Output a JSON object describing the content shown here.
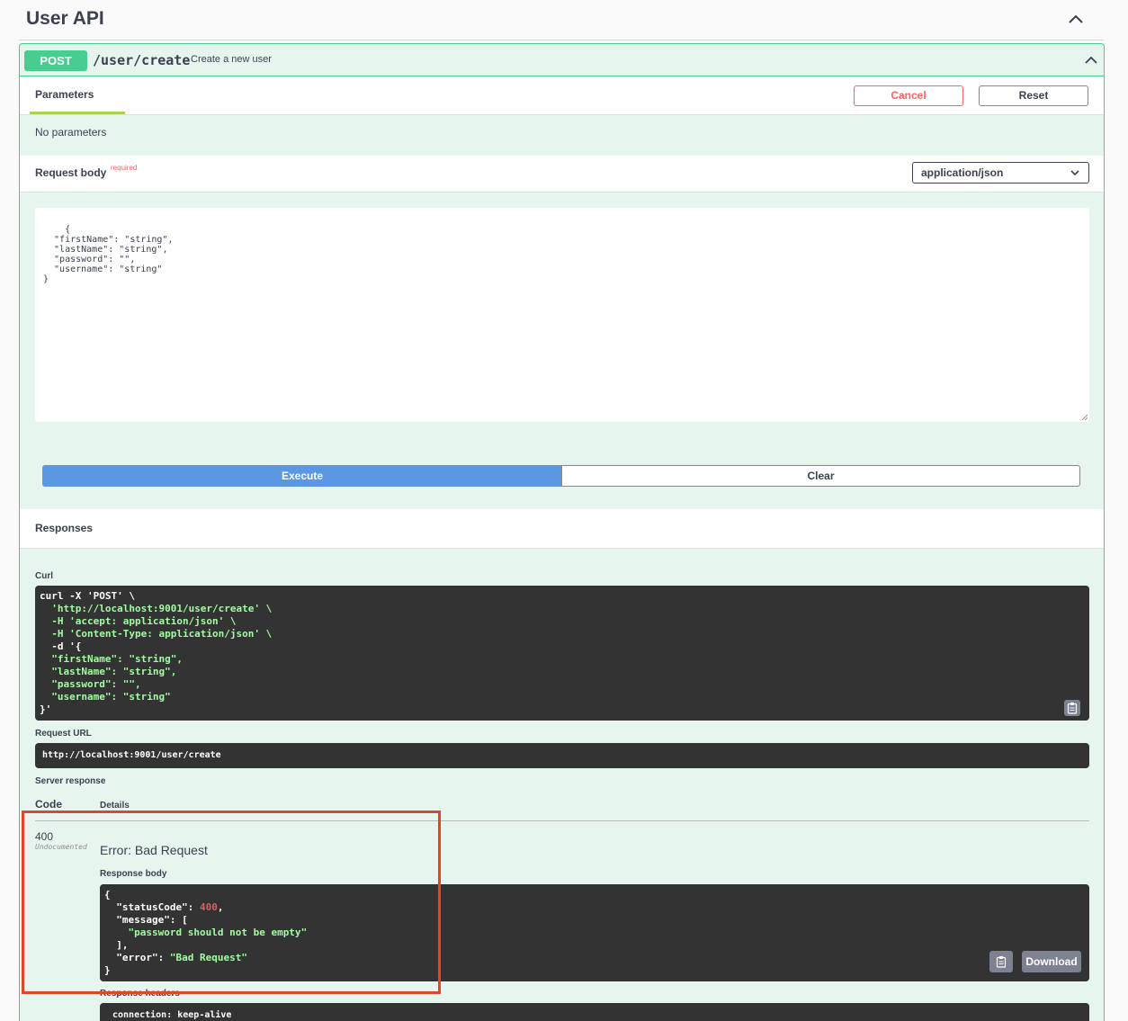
{
  "section": {
    "title": "User API"
  },
  "operation": {
    "method": "POST",
    "path": "/user/create",
    "summary": "Create a new user"
  },
  "parameters": {
    "tab_label": "Parameters",
    "cancel_label": "Cancel",
    "reset_label": "Reset",
    "empty_text": "No parameters"
  },
  "request_body": {
    "title": "Request body",
    "required_label": "required",
    "content_type": "application/json",
    "value": "{\n  \"firstName\": \"string\",\n  \"lastName\": \"string\",\n  \"password\": \"\",\n  \"username\": \"string\"\n}"
  },
  "actions": {
    "execute_label": "Execute",
    "clear_label": "Clear"
  },
  "responses": {
    "title": "Responses",
    "curl_label": "Curl",
    "curl_lines": [
      "curl -X 'POST' \\",
      "  'http://localhost:9001/user/create' \\",
      "  -H 'accept: application/json' \\",
      "  -H 'Content-Type: application/json' \\",
      "  -d '{",
      "  \"firstName\": \"string\",",
      "  \"lastName\": \"string\",",
      "  \"password\": \"\",",
      "  \"username\": \"string\"",
      "}'"
    ],
    "request_url_label": "Request URL",
    "request_url": "http://localhost:9001/user/create",
    "server_response_label": "Server response",
    "code_header": "Code",
    "details_header": "Details",
    "status_code": "400",
    "undocumented_label": "Undocumented",
    "error_title": "Error: Bad Request",
    "response_body_label": "Response body",
    "response_body": {
      "statusCode": 400,
      "message": "password should not be empty",
      "error": "Bad Request"
    },
    "download_label": "Download",
    "response_headers_label": "Response headers",
    "response_headers_first": "connection: keep-alive"
  },
  "colors": {
    "post_green": "#49cc90",
    "execute_blue": "#5b97e2",
    "cancel_red": "#ff6060",
    "highlight_red": "#e0472a",
    "code_bg": "#333333",
    "code_string": "#a2fca2",
    "code_number": "#d36363"
  }
}
